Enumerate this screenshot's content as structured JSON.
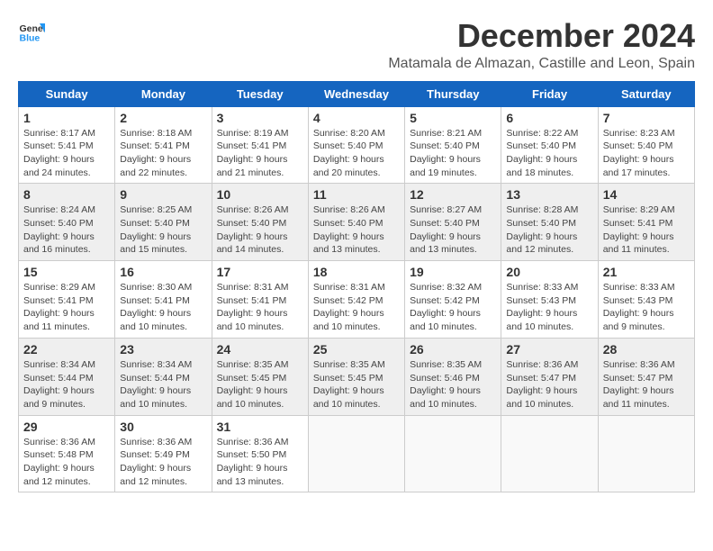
{
  "header": {
    "logo_general": "General",
    "logo_blue": "Blue",
    "month_year": "December 2024",
    "location": "Matamala de Almazan, Castille and Leon, Spain"
  },
  "weekdays": [
    "Sunday",
    "Monday",
    "Tuesday",
    "Wednesday",
    "Thursday",
    "Friday",
    "Saturday"
  ],
  "weeks": [
    [
      {
        "day": "1",
        "sunrise": "8:17 AM",
        "sunset": "5:41 PM",
        "daylight": "9 hours and 24 minutes."
      },
      {
        "day": "2",
        "sunrise": "8:18 AM",
        "sunset": "5:41 PM",
        "daylight": "9 hours and 22 minutes."
      },
      {
        "day": "3",
        "sunrise": "8:19 AM",
        "sunset": "5:41 PM",
        "daylight": "9 hours and 21 minutes."
      },
      {
        "day": "4",
        "sunrise": "8:20 AM",
        "sunset": "5:40 PM",
        "daylight": "9 hours and 20 minutes."
      },
      {
        "day": "5",
        "sunrise": "8:21 AM",
        "sunset": "5:40 PM",
        "daylight": "9 hours and 19 minutes."
      },
      {
        "day": "6",
        "sunrise": "8:22 AM",
        "sunset": "5:40 PM",
        "daylight": "9 hours and 18 minutes."
      },
      {
        "day": "7",
        "sunrise": "8:23 AM",
        "sunset": "5:40 PM",
        "daylight": "9 hours and 17 minutes."
      }
    ],
    [
      {
        "day": "8",
        "sunrise": "8:24 AM",
        "sunset": "5:40 PM",
        "daylight": "9 hours and 16 minutes."
      },
      {
        "day": "9",
        "sunrise": "8:25 AM",
        "sunset": "5:40 PM",
        "daylight": "9 hours and 15 minutes."
      },
      {
        "day": "10",
        "sunrise": "8:26 AM",
        "sunset": "5:40 PM",
        "daylight": "9 hours and 14 minutes."
      },
      {
        "day": "11",
        "sunrise": "8:26 AM",
        "sunset": "5:40 PM",
        "daylight": "9 hours and 13 minutes."
      },
      {
        "day": "12",
        "sunrise": "8:27 AM",
        "sunset": "5:40 PM",
        "daylight": "9 hours and 13 minutes."
      },
      {
        "day": "13",
        "sunrise": "8:28 AM",
        "sunset": "5:40 PM",
        "daylight": "9 hours and 12 minutes."
      },
      {
        "day": "14",
        "sunrise": "8:29 AM",
        "sunset": "5:41 PM",
        "daylight": "9 hours and 11 minutes."
      }
    ],
    [
      {
        "day": "15",
        "sunrise": "8:29 AM",
        "sunset": "5:41 PM",
        "daylight": "9 hours and 11 minutes."
      },
      {
        "day": "16",
        "sunrise": "8:30 AM",
        "sunset": "5:41 PM",
        "daylight": "9 hours and 10 minutes."
      },
      {
        "day": "17",
        "sunrise": "8:31 AM",
        "sunset": "5:41 PM",
        "daylight": "9 hours and 10 minutes."
      },
      {
        "day": "18",
        "sunrise": "8:31 AM",
        "sunset": "5:42 PM",
        "daylight": "9 hours and 10 minutes."
      },
      {
        "day": "19",
        "sunrise": "8:32 AM",
        "sunset": "5:42 PM",
        "daylight": "9 hours and 10 minutes."
      },
      {
        "day": "20",
        "sunrise": "8:33 AM",
        "sunset": "5:43 PM",
        "daylight": "9 hours and 10 minutes."
      },
      {
        "day": "21",
        "sunrise": "8:33 AM",
        "sunset": "5:43 PM",
        "daylight": "9 hours and 9 minutes."
      }
    ],
    [
      {
        "day": "22",
        "sunrise": "8:34 AM",
        "sunset": "5:44 PM",
        "daylight": "9 hours and 9 minutes."
      },
      {
        "day": "23",
        "sunrise": "8:34 AM",
        "sunset": "5:44 PM",
        "daylight": "9 hours and 10 minutes."
      },
      {
        "day": "24",
        "sunrise": "8:35 AM",
        "sunset": "5:45 PM",
        "daylight": "9 hours and 10 minutes."
      },
      {
        "day": "25",
        "sunrise": "8:35 AM",
        "sunset": "5:45 PM",
        "daylight": "9 hours and 10 minutes."
      },
      {
        "day": "26",
        "sunrise": "8:35 AM",
        "sunset": "5:46 PM",
        "daylight": "9 hours and 10 minutes."
      },
      {
        "day": "27",
        "sunrise": "8:36 AM",
        "sunset": "5:47 PM",
        "daylight": "9 hours and 10 minutes."
      },
      {
        "day": "28",
        "sunrise": "8:36 AM",
        "sunset": "5:47 PM",
        "daylight": "9 hours and 11 minutes."
      }
    ],
    [
      {
        "day": "29",
        "sunrise": "8:36 AM",
        "sunset": "5:48 PM",
        "daylight": "9 hours and 12 minutes."
      },
      {
        "day": "30",
        "sunrise": "8:36 AM",
        "sunset": "5:49 PM",
        "daylight": "9 hours and 12 minutes."
      },
      {
        "day": "31",
        "sunrise": "8:36 AM",
        "sunset": "5:50 PM",
        "daylight": "9 hours and 13 minutes."
      },
      null,
      null,
      null,
      null
    ]
  ],
  "labels": {
    "sunrise": "Sunrise:",
    "sunset": "Sunset:",
    "daylight": "Daylight:"
  }
}
